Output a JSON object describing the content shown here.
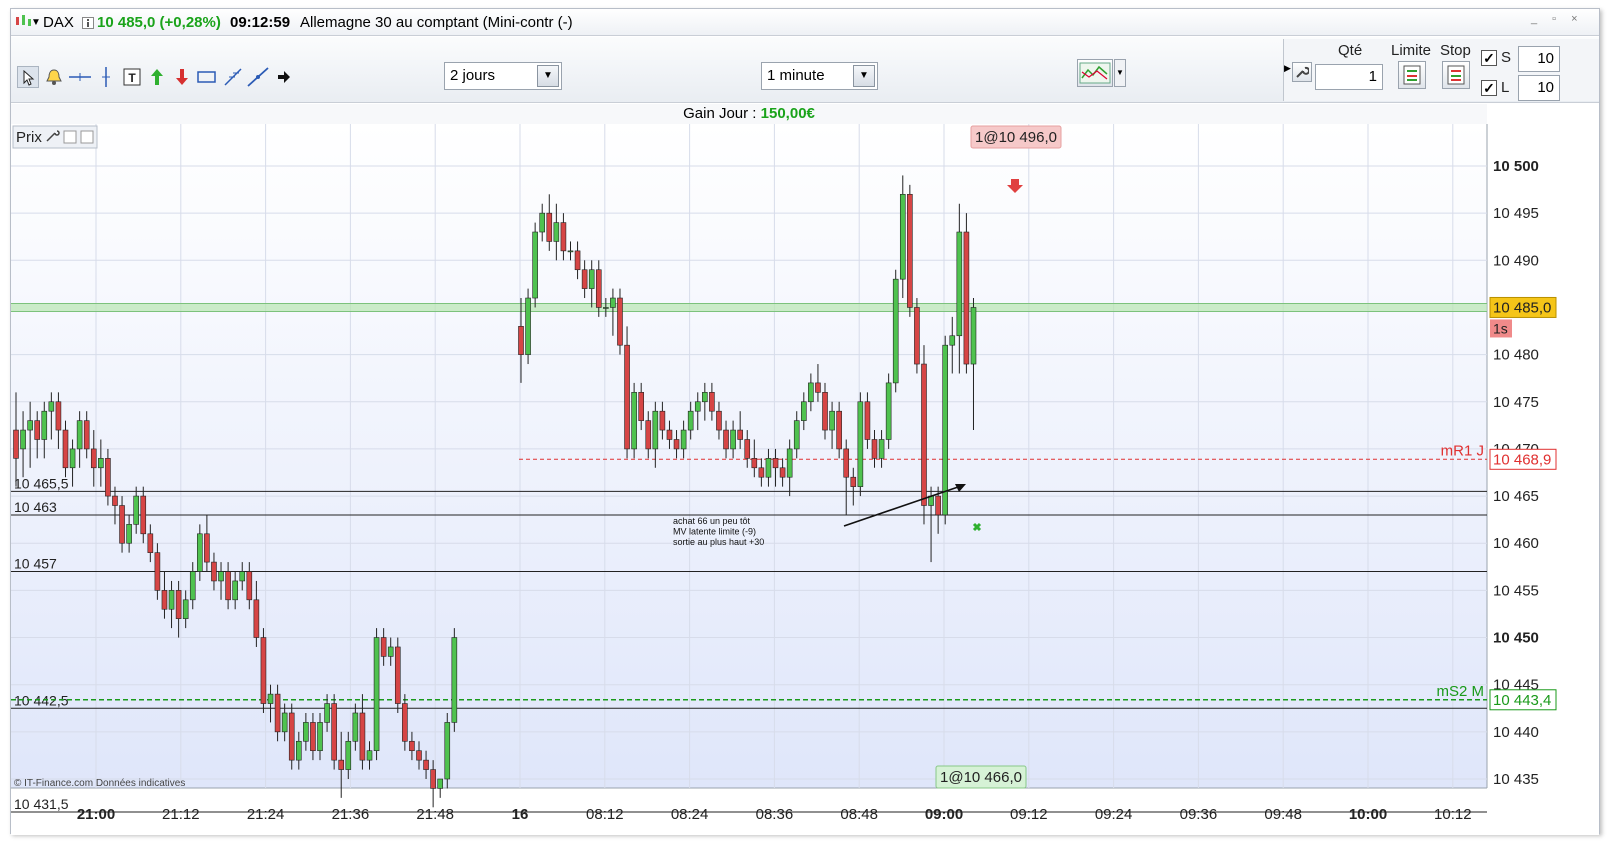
{
  "header": {
    "symbol": "DAX",
    "price": "10 485,0 (+0,28%)",
    "time": "09:12:59",
    "instrument": "Allemagne 30 au comptant (Mini-contr (-)",
    "win_controls": "_ ▫ ×"
  },
  "toolbar": {
    "period_value": "2 jours",
    "interval_value": "1 minute",
    "tool_icons": [
      "cursor-icon",
      "alarm-bell-icon",
      "crosshair-icon",
      "vertical-line-icon",
      "text-tool-icon",
      "buy-arrow-icon",
      "sell-arrow-icon",
      "rectangle-tool-icon",
      "fibonacci-icon",
      "trendline-icon",
      "next-arrow-icon"
    ]
  },
  "order_panel": {
    "qty_label": "Qté",
    "qty_value": "1",
    "limit_label": "Limite",
    "stop_label": "Stop",
    "s_label": "S",
    "s_value": "10",
    "l_label": "L",
    "l_value": "10"
  },
  "gain": {
    "label": "Gain Jour : ",
    "value": "150,00€"
  },
  "chart_data": {
    "type": "candlestick",
    "panel_label": "Prix",
    "ylim": [
      10431,
      10504
    ],
    "y_ticks": [
      {
        "v": 10500,
        "label": "10 500",
        "bold": true
      },
      {
        "v": 10495,
        "label": "10 495",
        "bold": false
      },
      {
        "v": 10490,
        "label": "10 490",
        "bold": false
      },
      {
        "v": 10480,
        "label": "10 480",
        "bold": false
      },
      {
        "v": 10475,
        "label": "10 475",
        "bold": false
      },
      {
        "v": 10470,
        "label": "10 470",
        "bold": false
      },
      {
        "v": 10465,
        "label": "10 465",
        "bold": false
      },
      {
        "v": 10460,
        "label": "10 460",
        "bold": false
      },
      {
        "v": 10455,
        "label": "10 455",
        "bold": false
      },
      {
        "v": 10450,
        "label": "10 450",
        "bold": true
      },
      {
        "v": 10445,
        "label": "10 445",
        "bold": false
      },
      {
        "v": 10440,
        "label": "10 440",
        "bold": false
      },
      {
        "v": 10435,
        "label": "10 435",
        "bold": false
      }
    ],
    "x_ticks": [
      {
        "label": "21:00",
        "bold": true
      },
      {
        "label": "21:12",
        "bold": false
      },
      {
        "label": "21:24",
        "bold": false
      },
      {
        "label": "21:36",
        "bold": false
      },
      {
        "label": "21:48",
        "bold": false
      },
      {
        "label": "16",
        "bold": true
      },
      {
        "label": "08:12",
        "bold": false
      },
      {
        "label": "08:24",
        "bold": false
      },
      {
        "label": "08:36",
        "bold": false
      },
      {
        "label": "08:48",
        "bold": false
      },
      {
        "label": "09:00",
        "bold": true
      },
      {
        "label": "09:12",
        "bold": false
      },
      {
        "label": "09:24",
        "bold": false
      },
      {
        "label": "09:36",
        "bold": false
      },
      {
        "label": "09:48",
        "bold": false
      },
      {
        "label": "10:00",
        "bold": true
      },
      {
        "label": "10:12",
        "bold": false
      }
    ],
    "levels": [
      {
        "v": 10465.5,
        "label": "10 465,5"
      },
      {
        "v": 10463,
        "label": "10 463"
      },
      {
        "v": 10457,
        "label": "10 457"
      },
      {
        "v": 10442.5,
        "label": "10 442,5"
      },
      {
        "v": 10431.5,
        "label": "10 431,5"
      }
    ],
    "current_price": {
      "v": 10485.0,
      "label": "10 485,0",
      "timer": "1s",
      "color": "#f5c518"
    },
    "pivot_r1": {
      "v": 10468.9,
      "name": "mR1 J",
      "label": "10 468,9",
      "color": "#e03030"
    },
    "pivot_s2": {
      "v": 10443.4,
      "name": "mS2 M",
      "label": "10 443,4",
      "color": "#1a9a1a"
    },
    "trade_high": {
      "label": "1@10 496,0"
    },
    "trade_low": {
      "label": "1@10 466,0"
    },
    "annotation": [
      "achat 66 un peu tôt",
      "MV latente limite (-9)",
      "sortie au plus haut +30"
    ],
    "footer_credit": "© IT-Finance.com  Données indicatives",
    "colors": {
      "up": "#4fc24f",
      "down": "#d64545",
      "wick": "#222222"
    },
    "session1": [
      [
        10472,
        10476,
        10466,
        10469
      ],
      [
        10470,
        10474,
        10467,
        10472
      ],
      [
        10472,
        10475,
        10468,
        10473
      ],
      [
        10473,
        10474,
        10469,
        10471
      ],
      [
        10471,
        10475,
        10469,
        10474
      ],
      [
        10474,
        10476,
        10471,
        10475
      ],
      [
        10475,
        10476,
        10470,
        10472
      ],
      [
        10472,
        10473,
        10467,
        10468
      ],
      [
        10468,
        10471,
        10466,
        10470
      ],
      [
        10470,
        10474,
        10468,
        10473
      ],
      [
        10473,
        10474,
        10469,
        10470
      ],
      [
        10470,
        10472,
        10466,
        10468
      ],
      [
        10468,
        10471,
        10466,
        10469
      ],
      [
        10469,
        10470,
        10464,
        10465
      ],
      [
        10465,
        10466,
        10462,
        10464
      ],
      [
        10464,
        10465,
        10459,
        10460
      ],
      [
        10460,
        10463,
        10459,
        10462
      ],
      [
        10462,
        10466,
        10461,
        10465
      ],
      [
        10465,
        10466,
        10460,
        10461
      ],
      [
        10461,
        10462,
        10458,
        10459
      ],
      [
        10459,
        10460,
        10454,
        10455
      ],
      [
        10455,
        10457,
        10452,
        10453
      ],
      [
        10453,
        10456,
        10451,
        10455
      ],
      [
        10455,
        10456,
        10450,
        10452
      ],
      [
        10452,
        10455,
        10451,
        10454
      ],
      [
        10454,
        10458,
        10453,
        10457
      ],
      [
        10457,
        10462,
        10456,
        10461
      ],
      [
        10461,
        10463,
        10457,
        10458
      ],
      [
        10458,
        10459,
        10455,
        10456
      ],
      [
        10456,
        10458,
        10454,
        10457
      ],
      [
        10457,
        10458,
        10453,
        10454
      ],
      [
        10454,
        10457,
        10453,
        10456
      ],
      [
        10456,
        10458,
        10455,
        10457
      ],
      [
        10457,
        10458,
        10453,
        10454
      ],
      [
        10454,
        10456,
        10449,
        10450
      ],
      [
        10450,
        10451,
        10442,
        10443
      ],
      [
        10443,
        10445,
        10441,
        10444
      ],
      [
        10444,
        10445,
        10439,
        10440
      ],
      [
        10440,
        10443,
        10439,
        10442
      ],
      [
        10442,
        10443,
        10436,
        10437
      ],
      [
        10437,
        10440,
        10436,
        10439
      ],
      [
        10439,
        10442,
        10438,
        10441
      ],
      [
        10441,
        10442,
        10437,
        10438
      ],
      [
        10438,
        10442,
        10437,
        10441
      ],
      [
        10441,
        10444,
        10440,
        10443
      ],
      [
        10443,
        10444,
        10436,
        10437
      ],
      [
        10437,
        10440,
        10433,
        10436
      ],
      [
        10436,
        10440,
        10435,
        10439
      ],
      [
        10439,
        10443,
        10438,
        10442
      ],
      [
        10442,
        10444,
        10436,
        10437
      ],
      [
        10437,
        10439,
        10436,
        10438
      ],
      [
        10438,
        10451,
        10437,
        10450
      ],
      [
        10450,
        10451,
        10447,
        10448
      ],
      [
        10448,
        10450,
        10447,
        10449
      ],
      [
        10449,
        10450,
        10442,
        10443
      ],
      [
        10443,
        10444,
        10438,
        10439
      ],
      [
        10439,
        10440,
        10437,
        10438
      ],
      [
        10438,
        10439,
        10436,
        10437
      ],
      [
        10437,
        10438,
        10435,
        10436
      ],
      [
        10436,
        10437,
        10432,
        10434
      ],
      [
        10434,
        10435,
        10433,
        10435
      ],
      [
        10435,
        10442,
        10434,
        10441
      ],
      [
        10441,
        10451,
        10440,
        10450
      ]
    ],
    "session2": [
      [
        10483,
        10486,
        10477,
        10480
      ],
      [
        10480,
        10487,
        10479,
        10486
      ],
      [
        10486,
        10494,
        10485,
        10493
      ],
      [
        10493,
        10496,
        10492,
        10495
      ],
      [
        10495,
        10497,
        10491,
        10492
      ],
      [
        10492,
        10496,
        10490,
        10494
      ],
      [
        10494,
        10495,
        10490,
        10491
      ],
      [
        10491,
        10492,
        10490,
        10491
      ],
      [
        10491,
        10492,
        10488,
        10489
      ],
      [
        10489,
        10490,
        10486,
        10487
      ],
      [
        10487,
        10490,
        10485,
        10489
      ],
      [
        10489,
        10490,
        10484,
        10485
      ],
      [
        10485,
        10486,
        10484,
        10485
      ],
      [
        10485,
        10487,
        10482,
        10486
      ],
      [
        10486,
        10487,
        10480,
        10481
      ],
      [
        10481,
        10483,
        10469,
        10470
      ],
      [
        10470,
        10477,
        10469,
        10476
      ],
      [
        10476,
        10477,
        10472,
        10473
      ],
      [
        10473,
        10474,
        10469,
        10470
      ],
      [
        10470,
        10475,
        10468,
        10474
      ],
      [
        10474,
        10475,
        10471,
        10472
      ],
      [
        10472,
        10473,
        10470,
        10471
      ],
      [
        10471,
        10472,
        10469,
        10470
      ],
      [
        10470,
        10473,
        10469,
        10472
      ],
      [
        10472,
        10475,
        10471,
        10474
      ],
      [
        10474,
        10476,
        10472,
        10475
      ],
      [
        10475,
        10477,
        10473,
        10476
      ],
      [
        10476,
        10477,
        10473,
        10474
      ],
      [
        10474,
        10475,
        10471,
        10472
      ],
      [
        10472,
        10473,
        10469,
        10470
      ],
      [
        10470,
        10473,
        10469,
        10472
      ],
      [
        10472,
        10474,
        10470,
        10471
      ],
      [
        10471,
        10472,
        10468,
        10469
      ],
      [
        10469,
        10471,
        10467,
        10468
      ],
      [
        10468,
        10469,
        10466,
        10467
      ],
      [
        10467,
        10470,
        10466,
        10469
      ],
      [
        10469,
        10470,
        10466,
        10468
      ],
      [
        10468,
        10469,
        10466,
        10467
      ],
      [
        10467,
        10471,
        10465,
        10470
      ],
      [
        10470,
        10474,
        10469,
        10473
      ],
      [
        10473,
        10476,
        10472,
        10475
      ],
      [
        10475,
        10478,
        10474,
        10477
      ],
      [
        10477,
        10479,
        10475,
        10476
      ],
      [
        10476,
        10477,
        10471,
        10472
      ],
      [
        10472,
        10475,
        10470,
        10474
      ],
      [
        10474,
        10475,
        10469,
        10470
      ],
      [
        10470,
        10471,
        10463,
        10467
      ],
      [
        10467,
        10468,
        10464,
        10466
      ],
      [
        10466,
        10476,
        10465,
        10475
      ],
      [
        10475,
        10476,
        10470,
        10471
      ],
      [
        10471,
        10472,
        10468,
        10469
      ],
      [
        10469,
        10472,
        10468,
        10471
      ],
      [
        10471,
        10478,
        10470,
        10477
      ],
      [
        10477,
        10489,
        10476,
        10488
      ],
      [
        10488,
        10499,
        10486,
        10497
      ],
      [
        10497,
        10498,
        10484,
        10485
      ],
      [
        10485,
        10486,
        10478,
        10479
      ],
      [
        10479,
        10481,
        10462,
        10464
      ],
      [
        10464,
        10466,
        10458,
        10465
      ],
      [
        10465,
        10466,
        10461,
        10463
      ],
      [
        10463,
        10482,
        10462,
        10481
      ],
      [
        10481,
        10484,
        10478,
        10482
      ],
      [
        10482,
        10496,
        10478,
        10493
      ],
      [
        10493,
        10495,
        10478,
        10479
      ],
      [
        10479,
        10486,
        10472,
        10485
      ]
    ]
  }
}
